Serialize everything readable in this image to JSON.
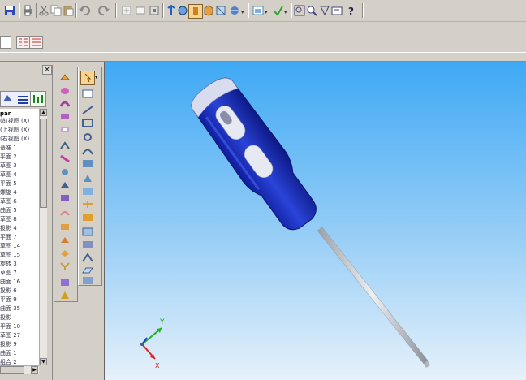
{
  "colors": {
    "face": "#d4d0c8",
    "viewport_top": "#3fa9f5",
    "viewport_bottom": "#e6f1fa",
    "handle_blue": "#1e34c8",
    "handle_light": "#d9dcee",
    "shaft": "#c8ccd2",
    "axis_x": "#e02020",
    "axis_y": "#20b020",
    "axis_z": "#2040e0",
    "selected_tool": "#f0a030"
  },
  "toolbar": {
    "buttons": [
      "save-icon",
      "print-icon",
      "cut-icon",
      "copy-icon",
      "paste-icon",
      "undo-icon",
      "redo-icon",
      "insert-icon",
      "sketch-icon",
      "dimension-icon",
      "rotate-icon",
      "pan-icon",
      "select-icon",
      "box-icon",
      "shade-icon",
      "sphere-icon",
      "view-orient-icon",
      "display-style-icon",
      "zoom-fit-icon",
      "zoom-in-icon",
      "zoom-area-icon",
      "zoom-prev-icon",
      "help-icon"
    ]
  },
  "tree": {
    "header": "par",
    "items": [
      "(前视图 (X)",
      "(上视图 (X)",
      "(右视图 (X)",
      "基准 1",
      "平面 2",
      "草图 3",
      "草图 4",
      "平面 5",
      "螺旋 4",
      "草图 6",
      "曲面 5",
      "草图 8",
      "投影 4",
      "平面 7",
      "草图 14",
      "草图 15",
      "旋转 3",
      "草图 7",
      "曲面 16",
      "投影 6",
      "平面 9",
      "曲面 35",
      "投影",
      "平面 10",
      "草图 27",
      "投影 9",
      "曲面 1",
      "组合 2"
    ]
  },
  "viewport": {
    "axis_labels": {
      "x": "X",
      "y": "Y"
    }
  }
}
